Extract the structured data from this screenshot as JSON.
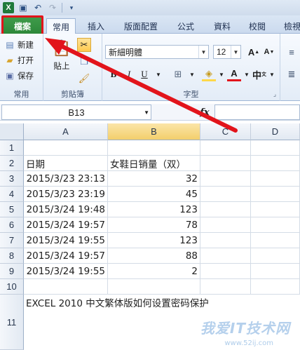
{
  "qat": {
    "logo": "X",
    "save_icon": "save-icon",
    "undo_icon": "undo-icon",
    "redo_icon": "redo-icon"
  },
  "tabs": {
    "file": "檔案",
    "items": [
      "常用",
      "插入",
      "版面配置",
      "公式",
      "資料",
      "校閱",
      "檢視"
    ],
    "active_index": 0
  },
  "ribbon": {
    "file_menu": {
      "new_label": "新建",
      "open_label": "打开",
      "save_label": "保存",
      "group_label": "常用"
    },
    "clipboard": {
      "paste_label": "貼上",
      "group_label": "剪貼簿"
    },
    "font": {
      "font_name": "新細明體",
      "font_size": "12",
      "bold": "B",
      "italic": "I",
      "underline": "U",
      "grow": "A",
      "shrink": "A",
      "phonetic": "中",
      "group_label": "字型"
    },
    "colors": {
      "accent_red": "#e2141b",
      "font_color": "#e2141b",
      "fill_color": "#ffd84a"
    }
  },
  "formula_bar": {
    "name_box": "B13",
    "fx": "fx",
    "formula": ""
  },
  "sheet": {
    "columns": [
      "A",
      "B",
      "C",
      "D"
    ],
    "selected_column": "B",
    "rows": [
      {
        "num": "1",
        "a": "",
        "b": ""
      },
      {
        "num": "2",
        "a": "日期",
        "b": "女鞋日销量（双）"
      },
      {
        "num": "3",
        "a": "2015/3/23 23:13",
        "b": "32"
      },
      {
        "num": "4",
        "a": "2015/3/23 23:19",
        "b": "45"
      },
      {
        "num": "5",
        "a": "2015/3/24 19:48",
        "b": "123"
      },
      {
        "num": "6",
        "a": "2015/3/24 19:57",
        "b": "78"
      },
      {
        "num": "7",
        "a": "2015/3/24 19:55",
        "b": "123"
      },
      {
        "num": "8",
        "a": "2015/3/24 19:57",
        "b": "88"
      },
      {
        "num": "9",
        "a": "2015/3/24 19:55",
        "b": "2"
      },
      {
        "num": "10",
        "a": "",
        "b": ""
      }
    ],
    "note_row": {
      "num": "11",
      "text": "EXCEL 2010 中文繁体版如何设置密码保护"
    }
  },
  "watermark": {
    "text": "我爱IT技术网",
    "url": "www.52ij.com"
  }
}
